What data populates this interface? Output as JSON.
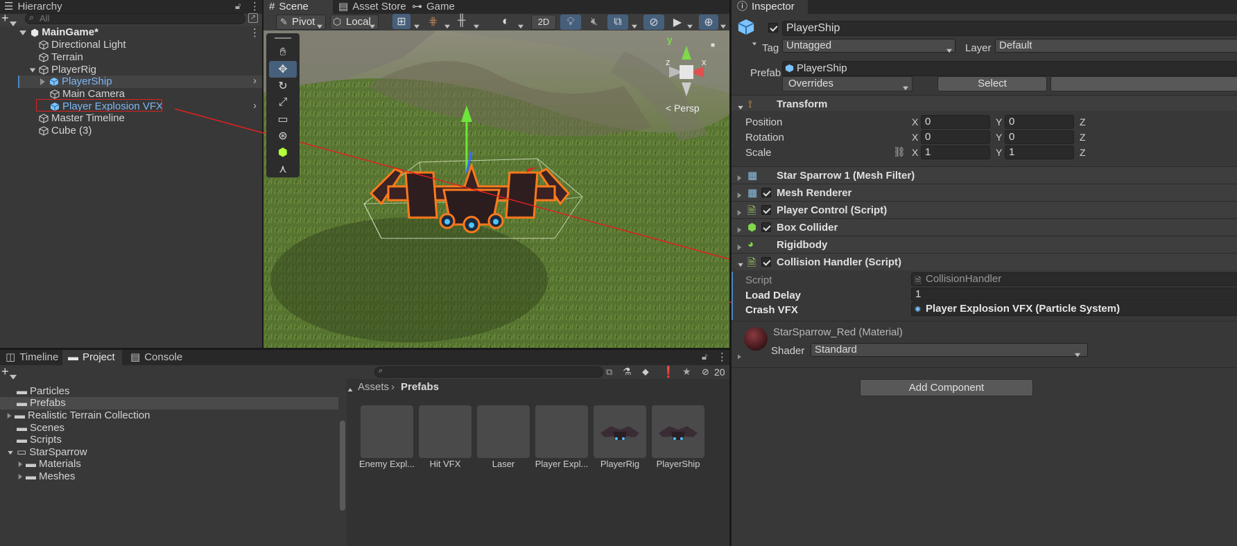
{
  "hierarchy": {
    "tab": "Hierarchy",
    "search_placeholder": "All",
    "scene_name": "MainGame*",
    "items": [
      {
        "label": "Directional Light"
      },
      {
        "label": "Terrain"
      },
      {
        "label": "PlayerRig"
      },
      {
        "label": "PlayerShip"
      },
      {
        "label": "Main Camera"
      },
      {
        "label": "Player Explosion VFX"
      },
      {
        "label": "Master Timeline"
      },
      {
        "label": "Cube (3)"
      }
    ]
  },
  "scene_tabs": {
    "scene": "Scene",
    "asset_store": "Asset Store",
    "game": "Game"
  },
  "scene_toolbar": {
    "pivot": "Pivot",
    "local": "Local",
    "mode_2d": "2D"
  },
  "gizmo": {
    "persp": "< Persp",
    "x": "x",
    "y": "y",
    "z": "z"
  },
  "inspector": {
    "tab": "Inspector",
    "object_name": "PlayerShip",
    "tag_label": "Tag",
    "tag_value": "Untagged",
    "layer_label": "Layer",
    "layer_value": "Default",
    "prefab_label": "Prefab",
    "prefab_value": "PlayerShip",
    "overrides": "Overrides",
    "select": "Select",
    "transform": {
      "title": "Transform",
      "position_label": "Position",
      "rotation_label": "Rotation",
      "scale_label": "Scale",
      "position": {
        "x": "0",
        "y": "0"
      },
      "rotation": {
        "x": "0",
        "y": "0"
      },
      "scale": {
        "x": "1",
        "y": "1"
      },
      "axis_x": "X",
      "axis_y": "Y",
      "axis_z": "Z"
    },
    "components": [
      {
        "label": "Star Sparrow 1 (Mesh Filter)"
      },
      {
        "label": "Mesh Renderer"
      },
      {
        "label": "Player Control (Script)"
      },
      {
        "label": "Box Collider"
      },
      {
        "label": "Rigidbody"
      },
      {
        "label": "Collision Handler (Script)"
      }
    ],
    "collision_handler": {
      "script_label": "Script",
      "script_value": "CollisionHandler",
      "load_delay_label": "Load Delay",
      "load_delay_value": "1",
      "crash_vfx_label": "Crash VFX",
      "crash_vfx_value": "Player Explosion VFX (Particle System)"
    },
    "material": {
      "name": "StarSparrow_Red (Material)",
      "shader_label": "Shader",
      "shader_value": "Standard"
    },
    "add_component": "Add Component"
  },
  "bottom": {
    "tabs": [
      "Timeline",
      "Project",
      "Console"
    ],
    "folders": [
      {
        "label": "Particles"
      },
      {
        "label": "Prefabs"
      },
      {
        "label": "Realistic Terrain Collection"
      },
      {
        "label": "Scenes"
      },
      {
        "label": "Scripts"
      },
      {
        "label": "StarSparrow"
      },
      {
        "label": "Materials"
      },
      {
        "label": "Meshes"
      }
    ],
    "breadcrumb_root": "Assets",
    "breadcrumb_current": "Prefabs",
    "hidden_count": "20",
    "assets": [
      {
        "label": "Enemy Expl..."
      },
      {
        "label": "Hit VFX"
      },
      {
        "label": "Laser"
      },
      {
        "label": "Player Expl..."
      },
      {
        "label": "PlayerRig"
      },
      {
        "label": "PlayerShip"
      }
    ]
  },
  "colors": {
    "accent": "#46607c",
    "prefab_blue": "#7cb6f6",
    "annotation_red": "#e02020"
  }
}
